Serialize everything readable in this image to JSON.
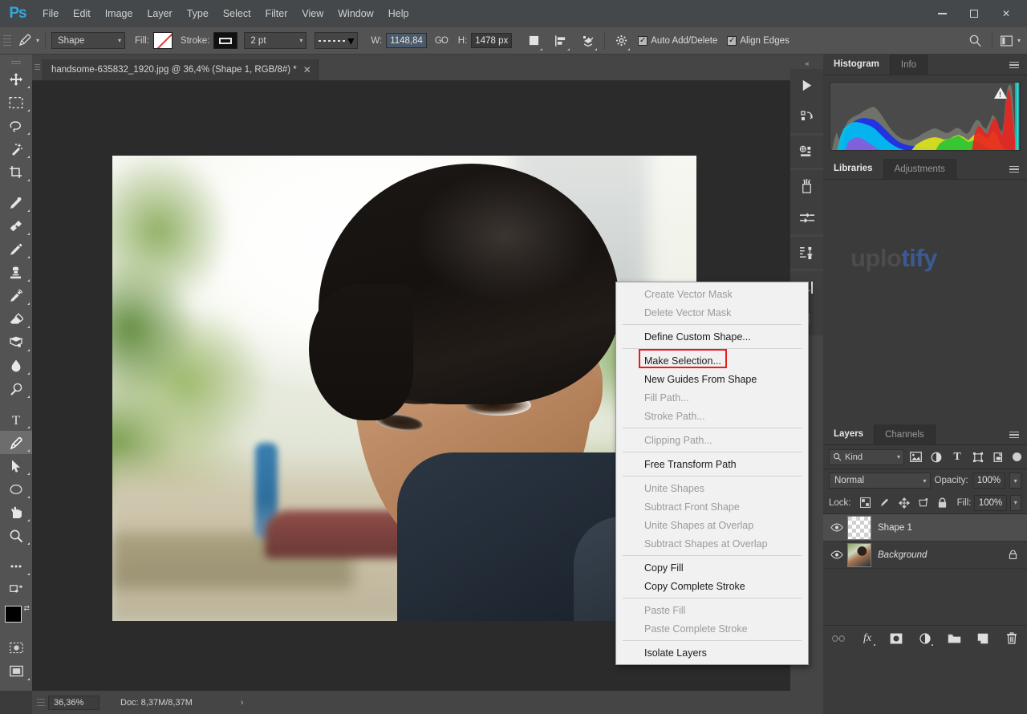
{
  "app": {
    "name": "Adobe Photoshop",
    "logo_text": "Ps",
    "accent_color": "#31a8e0"
  },
  "menubar": {
    "items": [
      "File",
      "Edit",
      "Image",
      "Layer",
      "Type",
      "Select",
      "Filter",
      "View",
      "Window",
      "Help"
    ]
  },
  "window_controls": {
    "minimize": "minimize-icon",
    "maximize": "maximize-icon",
    "close": "✕"
  },
  "options_bar": {
    "tool_icon": "pen-tool-icon",
    "path_mode": "Shape",
    "fill_label": "Fill:",
    "fill_value": "none",
    "stroke_label": "Stroke:",
    "stroke_swatch": "black",
    "stroke_weight": "2 pt",
    "stroke_style": "dashed",
    "width_label": "W:",
    "width_value": "1148,84",
    "link_label": "GO",
    "height_label": "H:",
    "height_value": "1478 px",
    "path_ops_icon": "path-operations-icon",
    "path_align_icon": "path-alignment-icon",
    "path_arrange_icon": "path-arrangement-icon",
    "gear_icon": "gear-icon",
    "auto_add_delete": "Auto Add/Delete",
    "auto_add_delete_checked": true,
    "align_edges": "Align Edges",
    "align_edges_checked": true,
    "search_icon": "search-icon",
    "workspace_icon": "workspace-icon"
  },
  "toolbar": {
    "tools": [
      {
        "name": "move-tool",
        "glyph": "move"
      },
      {
        "name": "rectangular-marquee-tool",
        "glyph": "marquee"
      },
      {
        "name": "lasso-tool",
        "glyph": "lasso"
      },
      {
        "name": "quick-selection-tool",
        "glyph": "wand"
      },
      {
        "name": "crop-tool",
        "glyph": "crop"
      },
      {
        "name": "eyedropper-tool",
        "glyph": "eyedropper"
      },
      {
        "name": "healing-brush-tool",
        "glyph": "healing"
      },
      {
        "name": "brush-tool",
        "glyph": "brush"
      },
      {
        "name": "clone-stamp-tool",
        "glyph": "stamp"
      },
      {
        "name": "history-brush-tool",
        "glyph": "historybrush"
      },
      {
        "name": "eraser-tool",
        "glyph": "eraser"
      },
      {
        "name": "gradient-tool",
        "glyph": "gradient"
      },
      {
        "name": "blur-tool",
        "glyph": "blur"
      },
      {
        "name": "dodge-tool",
        "glyph": "dodge"
      },
      {
        "name": "type-tool",
        "glyph": "type"
      },
      {
        "name": "pen-tool",
        "glyph": "pen",
        "active": true
      },
      {
        "name": "path-selection-tool",
        "glyph": "arrow"
      },
      {
        "name": "ellipse-tool",
        "glyph": "ellipse"
      },
      {
        "name": "hand-tool",
        "glyph": "hand"
      },
      {
        "name": "zoom-tool",
        "glyph": "zoom"
      },
      {
        "name": "more-tools",
        "glyph": "ellipsis"
      }
    ],
    "quick-mask": "quick-mask-icon",
    "screen-mode": "screen-mode-icon",
    "foreground_color": "#000000",
    "background_color": "#ffffff"
  },
  "document": {
    "tab_title": "handsome-635832_1920.jpg @ 36,4% (Shape 1, RGB/8#) *",
    "close_glyph": "✕"
  },
  "status_bar": {
    "zoom": "36,36%",
    "doc_info": "Doc: 8,37M/8,37M",
    "expand_glyph": "›"
  },
  "icon_dock": {
    "collapse_glyph": "«",
    "buttons": [
      {
        "name": "actions-play-icon"
      },
      {
        "name": "history-icon"
      },
      {
        "name": "properties-icon"
      },
      {
        "name": "brushes-icon"
      },
      {
        "name": "brush-settings-icon"
      },
      {
        "name": "clone-source-icon"
      },
      {
        "name": "character-icon"
      },
      {
        "name": "paragraph-icon"
      }
    ]
  },
  "panels": {
    "histogram": {
      "tabs": [
        {
          "label": "Histogram",
          "active": true
        },
        {
          "label": "Info",
          "active": false
        }
      ],
      "menu_icon": "panel-menu-icon",
      "warning_icon": "uncached-warning-icon"
    },
    "libraries": {
      "tabs": [
        {
          "label": "Libraries",
          "active": true
        },
        {
          "label": "Adjustments",
          "active": false
        }
      ],
      "menu_icon": "panel-menu-icon",
      "watermark_part1": "uplo",
      "watermark_part2": "tify",
      "watermark_color1": "#4c4c4c",
      "watermark_color2": "#3b5a93"
    },
    "layers": {
      "tabs": [
        {
          "label": "Layers",
          "active": true
        },
        {
          "label": "Channels",
          "active": false
        }
      ],
      "menu_icon": "panel-menu-icon",
      "filter_kind": "Kind",
      "filter_icons": [
        "filter-pixel-icon",
        "filter-adjustment-icon",
        "filter-type-icon",
        "filter-shape-icon",
        "filter-smart-object-icon"
      ],
      "filter_toggle": "filter-enable-toggle",
      "blend_mode": "Normal",
      "opacity_label": "Opacity:",
      "opacity_value": "100%",
      "lock_label": "Lock:",
      "lock_icons": [
        "lock-transparent-pixels-icon",
        "lock-image-pixels-icon",
        "lock-position-icon",
        "lock-artboard-nesting-icon",
        "lock-all-icon"
      ],
      "fill_label": "Fill:",
      "fill_value": "100%",
      "rows": [
        {
          "name": "Shape 1",
          "selected": true,
          "visible": true,
          "locked": false,
          "thumb": "vector-shape-thumbnail"
        },
        {
          "name": "Background",
          "selected": false,
          "visible": true,
          "locked": true,
          "italic": true,
          "thumb": "photo-thumbnail"
        }
      ],
      "footer_buttons": [
        {
          "name": "link-layers-button",
          "glyph": "link",
          "disabled": true
        },
        {
          "name": "layer-style-button",
          "glyph": "fx"
        },
        {
          "name": "layer-mask-button",
          "glyph": "mask"
        },
        {
          "name": "new-fill-adjustment-button",
          "glyph": "halfcircle"
        },
        {
          "name": "new-group-button",
          "glyph": "folder"
        },
        {
          "name": "new-layer-button",
          "glyph": "newlayer"
        },
        {
          "name": "delete-layer-button",
          "glyph": "trash"
        }
      ]
    }
  },
  "context_menu": {
    "highlighted_item": "Make Selection...",
    "highlight_color": "#ea1c1c",
    "groups": [
      [
        {
          "label": "Create Vector Mask",
          "enabled": false
        },
        {
          "label": "Delete Vector Mask",
          "enabled": false
        }
      ],
      [
        {
          "label": "Define Custom Shape...",
          "enabled": true
        }
      ],
      [
        {
          "label": "Make Selection...",
          "enabled": true,
          "highlighted": true
        },
        {
          "label": "New Guides From Shape",
          "enabled": true
        },
        {
          "label": "Fill Path...",
          "enabled": false
        },
        {
          "label": "Stroke Path...",
          "enabled": false
        }
      ],
      [
        {
          "label": "Clipping Path...",
          "enabled": false
        }
      ],
      [
        {
          "label": "Free Transform Path",
          "enabled": true
        }
      ],
      [
        {
          "label": "Unite Shapes",
          "enabled": false
        },
        {
          "label": "Subtract Front Shape",
          "enabled": false
        },
        {
          "label": "Unite Shapes at Overlap",
          "enabled": false
        },
        {
          "label": "Subtract Shapes at Overlap",
          "enabled": false
        }
      ],
      [
        {
          "label": "Copy Fill",
          "enabled": true
        },
        {
          "label": "Copy Complete Stroke",
          "enabled": true
        }
      ],
      [
        {
          "label": "Paste Fill",
          "enabled": false
        },
        {
          "label": "Paste Complete Stroke",
          "enabled": false
        }
      ],
      [
        {
          "label": "Isolate Layers",
          "enabled": true
        }
      ]
    ]
  },
  "canvas": {
    "image_description": "portrait-photo-young-man-outdoors"
  }
}
